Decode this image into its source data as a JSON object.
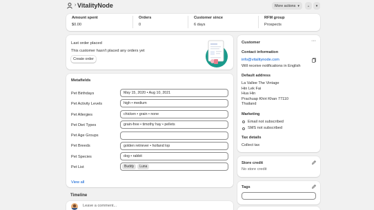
{
  "header": {
    "title": "VitalityNode",
    "more_actions": "More actions"
  },
  "stats": [
    {
      "label": "Amount spent",
      "value": "$0.00"
    },
    {
      "label": "Orders",
      "value": "0"
    },
    {
      "label": "Customer since",
      "value": "6 days"
    },
    {
      "label": "RFM group",
      "value": "Prospects"
    }
  ],
  "last_order": {
    "title": "Last order placed",
    "message": "This customer hasn't placed any orders yet",
    "button": "Create order"
  },
  "metafields": {
    "title": "Metafields",
    "rows": [
      {
        "label": "Pet Birthdays",
        "value": "May 15, 2020 • Aug 10, 2021"
      },
      {
        "label": "Pet Activity Levels",
        "value": "high • medium"
      },
      {
        "label": "Pet Allergies",
        "value": "chicken • grain • none"
      },
      {
        "label": "Pet Diet Types",
        "value": "grain-free • timothy hay • pellets"
      },
      {
        "label": "Pet Age Groups",
        "value": ""
      },
      {
        "label": "Pet Breeds",
        "value": "golden retriever • holland lop"
      },
      {
        "label": "Pet Species",
        "value": "dog • rabbit"
      },
      {
        "label": "Pet List",
        "value": ""
      }
    ],
    "pet_list_chips": [
      "Buddy",
      "Luna"
    ],
    "view_all": "View all"
  },
  "timeline": {
    "title": "Timeline",
    "comment_placeholder": "Leave a comment..."
  },
  "customer": {
    "title": "Customer",
    "contact_heading": "Contact information",
    "email": "info@vitalitynode.com",
    "notifications": "Will receive notifications in English",
    "address_heading": "Default address",
    "address_lines": [
      "La Vallee The Vintage",
      "Hin Lek Fai",
      "Hua Hin",
      "Prachuap Khiri Khan 77110",
      "Thailand"
    ],
    "marketing_heading": "Marketing",
    "email_marketing": "Email not subscribed",
    "sms_marketing": "SMS not subscribed",
    "tax_heading": "Tax details",
    "tax_value": "Collect tax"
  },
  "store_credit": {
    "title": "Store credit",
    "value": "No store credit"
  },
  "tags": {
    "title": "Tags"
  },
  "colors": {
    "background": "#f1f1f1",
    "link": "#005bd3",
    "card": "#ffffff"
  }
}
